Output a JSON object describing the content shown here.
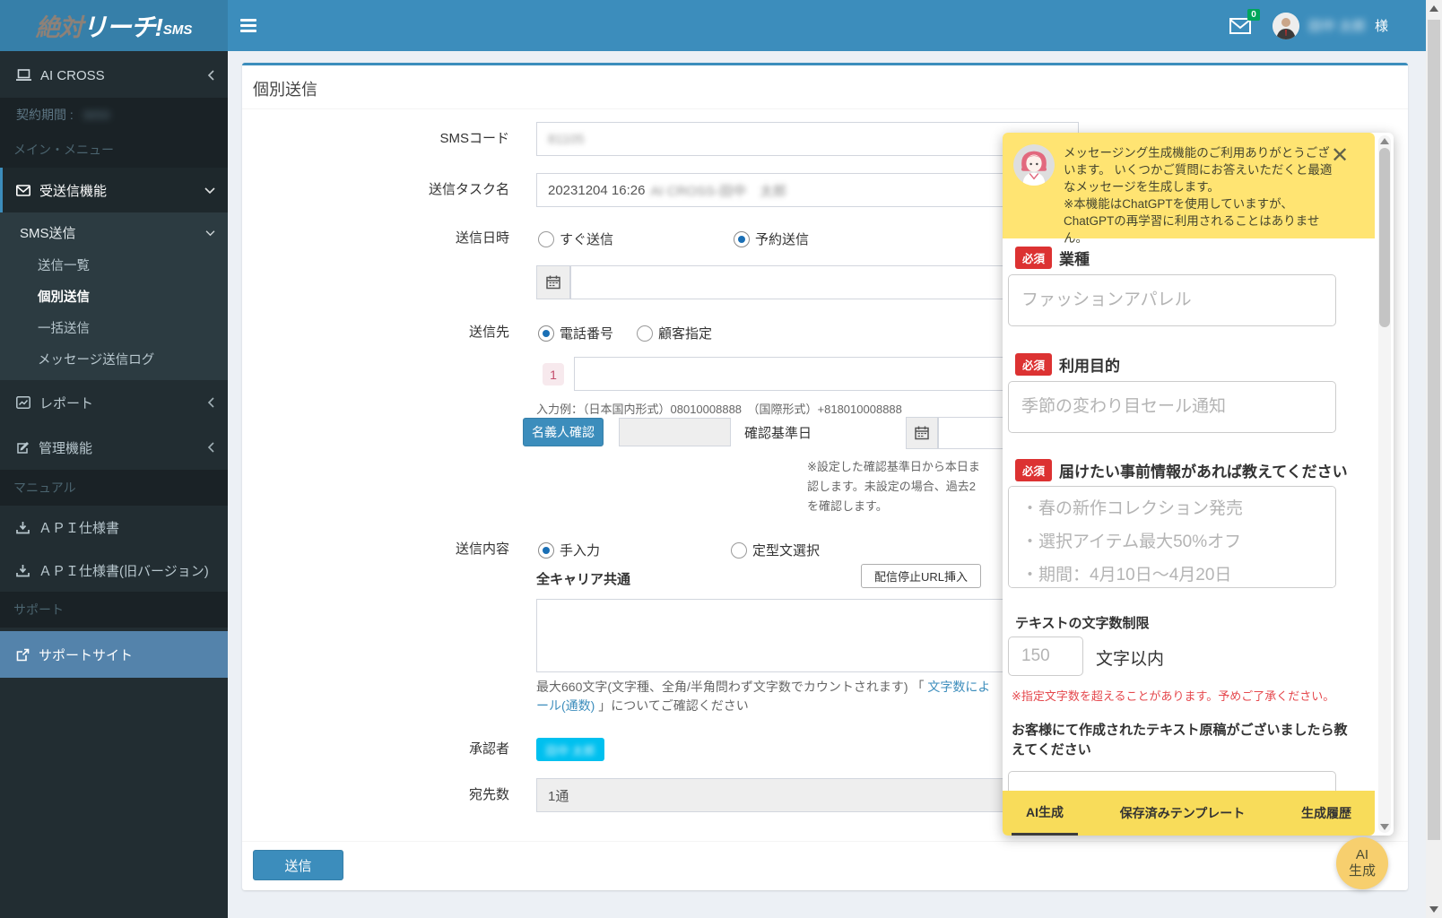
{
  "brand": {
    "part1": "絶対",
    "part2": "リーチ!",
    "part3": "SMS"
  },
  "topbar": {
    "mail_badge": "0",
    "user_name_blurred": "田中 太郎",
    "user_suffix": "様"
  },
  "sidebar": {
    "account_label": "AI CROSS",
    "contract_label": "契約期間 :",
    "contract_value_blurred": "3650",
    "main_menu_header": "メイン・メニュー",
    "inbox_menu": "受送信機能",
    "sms_group": "SMS送信",
    "sms_items": [
      "送信一覧",
      "個別送信",
      "一括送信",
      "メッセージ送信ログ"
    ],
    "report": "レポート",
    "admin": "管理機能",
    "manual_header": "マニュアル",
    "api_doc": "ＡＰＩ仕様書",
    "api_doc_old": "ＡＰＩ仕様書(旧バージョン)",
    "support_header": "サポート",
    "support_site": "サポートサイト"
  },
  "page": {
    "title": "個別送信"
  },
  "form": {
    "sms_code_label": "SMSコード",
    "sms_code_value_blurred": "81105",
    "task_name_label": "送信タスク名",
    "task_name_value": "20231204 16:26",
    "task_name_value_blurred": "AI CROSS-田中　太郎",
    "datetime_label": "送信日時",
    "radio_now": "すぐ送信",
    "radio_scheduled": "予約送信",
    "recipient_label": "送信先",
    "radio_phone": "電話番号",
    "radio_customer": "顧客指定",
    "phone_index": "1",
    "phone_hint": "入力例：（日本国内形式）08010008888　（国際形式）+818010008888",
    "name_check_button": "名義人確認",
    "base_date_label": "確認基準日",
    "base_date_note_1": "※設定した確認基準日から本日ま",
    "base_date_note_2": "認します。未設定の場合、過去2",
    "base_date_note_3": "を確認します。",
    "content_label": "送信内容",
    "radio_manual": "手入力",
    "radio_template": "定型文選択",
    "carrier_label": "全キャリア共通",
    "unsubscribe_button": "配信停止URL挿入",
    "max_note_prefix": "最大660文字(文字種、全角/半角問わず文字数でカウントされます) 「 ",
    "max_note_link1": "文字数によ",
    "max_note_link2": "ール(通数)",
    "max_note_suffix": " 」についてご確認ください",
    "approver_label": "承認者",
    "approver_value_blurred": "田中 太郎",
    "count_label": "宛先数",
    "count_value": "1通",
    "submit_button": "送信"
  },
  "ai_panel": {
    "intro_main": "メッセージング生成機能のご利用ありがとうございます。 いくつかご質問にお答えいただくと最適なメッセージを生成します。",
    "intro_note": "※本機能はChatGPTを使用していますが、ChatGPTの再学習に利用されることはありません。",
    "required_badge": "必須",
    "industry_label": "業種",
    "industry_placeholder": "ファッションアパレル",
    "purpose_label": "利用目的",
    "purpose_placeholder": "季節の変わり目セール通知",
    "info_label": "届けたい事前情報があれば教えてください",
    "info_placeholder": "・春の新作コレクション発売\n・選択アイテム最大50%オフ\n・期間：4月10日〜4月20日",
    "charlimit_label": "テキストの文字数制限",
    "charlimit_placeholder": "150",
    "charlimit_suffix": "文字以内",
    "charlimit_note": "※指定文字数を超えることがあります。予めご了承ください。",
    "draft_label": "お客様にて作成されたテキスト原稿がございましたら教えてください",
    "tabs": [
      "AI生成",
      "保存済みテンプレート",
      "生成履歴"
    ],
    "fab_line1": "AI",
    "fab_line2": "生成"
  }
}
